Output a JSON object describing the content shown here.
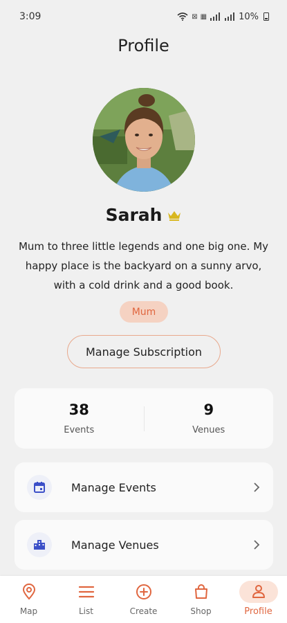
{
  "status_bar": {
    "time": "3:09",
    "icons": [
      "wifi-icon",
      "nfc-icon",
      "data-icon",
      "signal-icon",
      "signal-icon"
    ],
    "battery": "10%"
  },
  "header": {
    "title": "Profile"
  },
  "profile": {
    "name": "Sarah",
    "badge_icon": "crown-icon",
    "bio_lines": [
      "Mum to three little legends and one big one. My",
      "happy place is the backyard on a sunny arvo,",
      "with a cold drink and a good book."
    ],
    "tag": "Mum",
    "subscription_button": "Manage Subscription"
  },
  "stats": [
    {
      "value": "38",
      "label": "Events"
    },
    {
      "value": "9",
      "label": "Venues"
    }
  ],
  "menu": [
    {
      "label": "Manage Events",
      "icon": "calendar-icon"
    },
    {
      "label": "Manage Venues",
      "icon": "buildings-icon"
    }
  ],
  "bottom_nav": [
    {
      "label": "Map",
      "icon": "map-pin-icon"
    },
    {
      "label": "List",
      "icon": "list-icon"
    },
    {
      "label": "Create",
      "icon": "plus-circle-icon"
    },
    {
      "label": "Shop",
      "icon": "shopping-bag-icon"
    },
    {
      "label": "Profile",
      "icon": "user-icon",
      "active": true
    }
  ],
  "colors": {
    "accent": "#e0663f",
    "accent_light": "#f5d2c2",
    "background": "#f0f0f0",
    "card": "#fafafa",
    "icon_blue": "#3b4fc8",
    "crown": "#d8b71f"
  }
}
